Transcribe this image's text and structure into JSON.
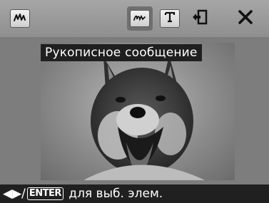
{
  "toolbar": {
    "handwriting_icon": "handwriting-pen-icon",
    "buttons": [
      {
        "icon": "handwritten-note-icon",
        "active": true
      },
      {
        "icon": "text-T-icon"
      },
      {
        "icon": "rotate-card-icon"
      },
      {
        "icon": "close-icon"
      }
    ]
  },
  "tooltip": {
    "text": "Рукописное сообщение"
  },
  "status": {
    "arrows": "◀▶/",
    "enter": "ENTER",
    "text": " для выб. элем."
  }
}
